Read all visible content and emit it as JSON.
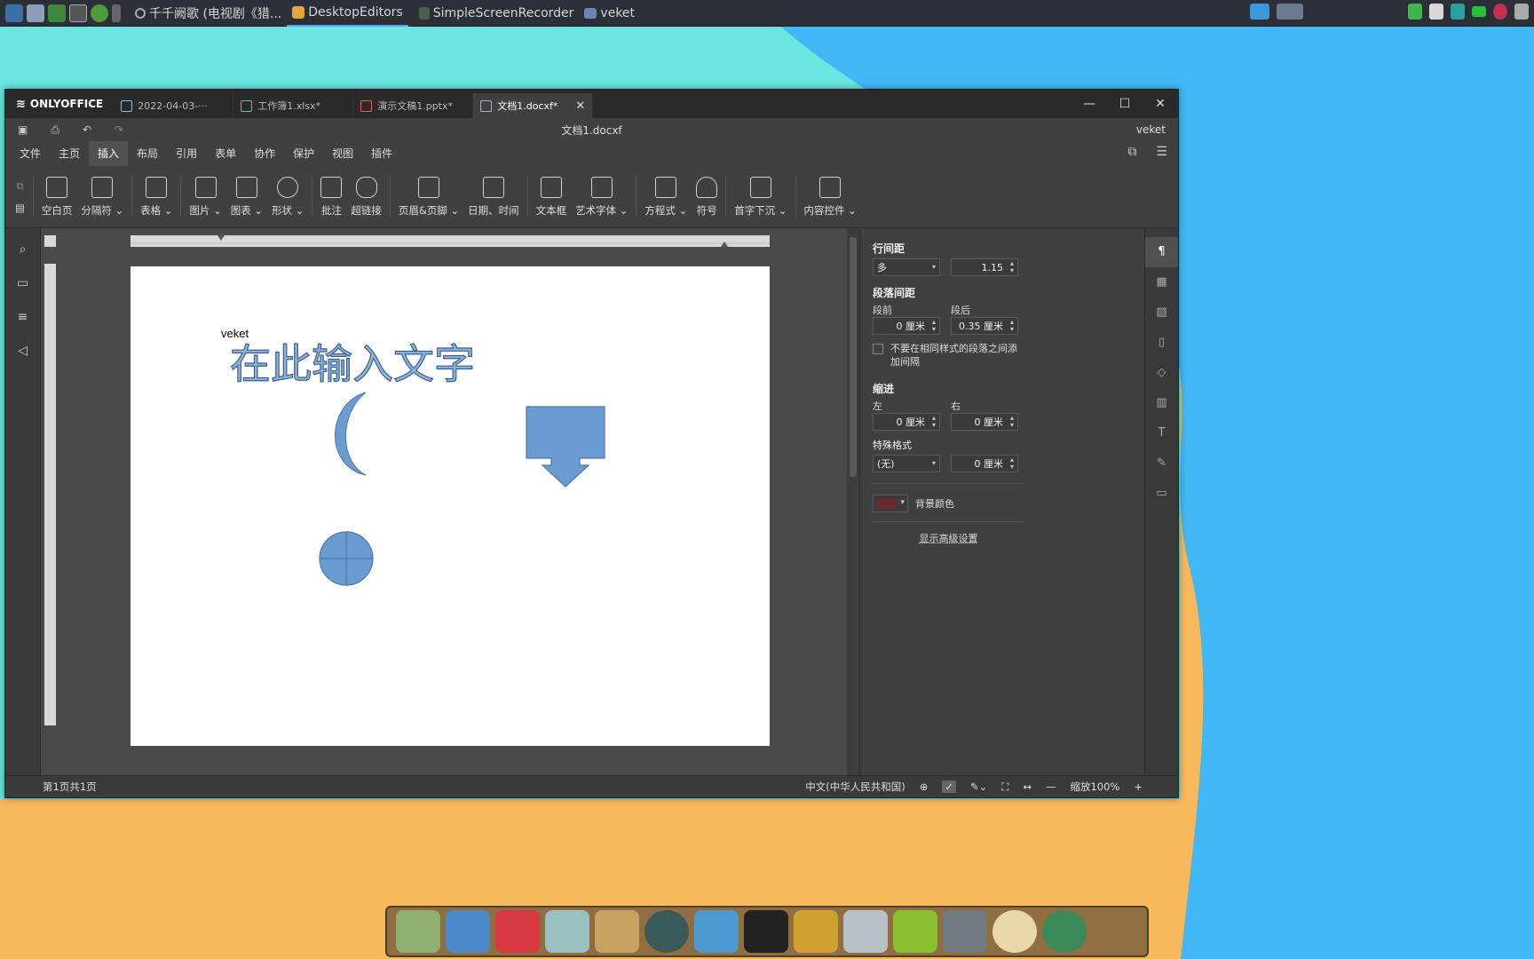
{
  "desktop": {
    "colors": {
      "orange": "#f7b95c",
      "blue": "#41b8f5",
      "cyan": "#6ce5e0"
    }
  },
  "panel": {
    "tasks": [
      {
        "label": "千千阙歌 (电视剧《猎...",
        "active": false
      },
      {
        "label": "DesktopEditors",
        "active": true
      },
      {
        "label": "SimpleScreenRecorder",
        "active": false
      },
      {
        "label": "veket",
        "active": false
      }
    ]
  },
  "window": {
    "logo": "ONLYOFFICE",
    "tabs": [
      {
        "label": "2022-04-03-···",
        "icon": "document-icon",
        "color": "#9bb4e0"
      },
      {
        "label": "工作簿1.xlsx*",
        "icon": "spreadsheet-icon",
        "color": "#6fc27a"
      },
      {
        "label": "演示文稿1.pptx*",
        "icon": "presentation-icon",
        "color": "#e06060"
      },
      {
        "label": "文档1.docxf*",
        "icon": "document-icon",
        "color": "#9bb4e0"
      }
    ],
    "doc_title": "文档1.docxf",
    "user": "veket",
    "menu": [
      "文件",
      "主页",
      "插入",
      "布局",
      "引用",
      "表单",
      "协作",
      "保护",
      "视图",
      "插件"
    ],
    "active_menu": "插入",
    "toolbar": [
      {
        "label": "空白页"
      },
      {
        "label": "分隔符 ⌄"
      },
      {
        "sep": true
      },
      {
        "label": "表格 ⌄"
      },
      {
        "sep": true
      },
      {
        "label": "图片 ⌄"
      },
      {
        "label": "图表 ⌄"
      },
      {
        "label": "形状 ⌄"
      },
      {
        "sep": true
      },
      {
        "label": "批注"
      },
      {
        "label": "超链接"
      },
      {
        "sep": true
      },
      {
        "label": "页眉&页脚 ⌄"
      },
      {
        "label": "日期、时间"
      },
      {
        "sep": true
      },
      {
        "label": "文本框"
      },
      {
        "label": "艺术字体 ⌄"
      },
      {
        "sep": true
      },
      {
        "label": "方程式 ⌄"
      },
      {
        "label": "符号"
      },
      {
        "sep": true
      },
      {
        "label": "首字下沉 ⌄"
      },
      {
        "sep": true
      },
      {
        "label": "内容控件 ⌄"
      }
    ],
    "document": {
      "typed_text": "veket",
      "wordart": "在此输入文字",
      "shape_color": "#6699cc"
    },
    "right_panel": {
      "line_spacing_title": "行间距",
      "line_spacing_mode": "多",
      "line_spacing_value": "1.15",
      "para_spacing_title": "段落间距",
      "before_label": "段前",
      "before_value": "0 厘米",
      "after_label": "段后",
      "after_value": "0.35 厘米",
      "no_space_label": "不要在相同样式的段落之间添加间隔",
      "indent_title": "缩进",
      "left_label": "左",
      "left_value": "0 厘米",
      "right_label": "右",
      "right_value": "0 厘米",
      "special_title": "特殊格式",
      "special_value": "(无)",
      "special_amount": "0 厘米",
      "bg_color_label": "背景颜色",
      "advanced_link": "显示高级设置"
    },
    "status": {
      "page_info": "第1页共1页",
      "language": "中文(中华人民共和国)",
      "zoom": "缩放100%"
    }
  }
}
